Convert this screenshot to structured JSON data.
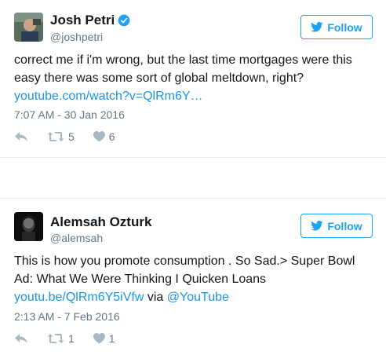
{
  "colors": {
    "accent": "#1da1f2",
    "link": "#1b95e0",
    "muted": "#657786",
    "icon": "#aab8c2",
    "text": "#14171a"
  },
  "tweets": [
    {
      "author": {
        "name": "Josh Petri",
        "handle": "@joshpetri",
        "verified": true,
        "avatar_icon": "profile-photo"
      },
      "follow_label": "Follow",
      "text": "correct me if i'm wrong, but the last time mortgages were this easy there was some sort of global meltdown, right?",
      "link_text": "youtube.com/watch?v=QlRm6Y…",
      "timestamp": "7:07 AM - 30 Jan 2016",
      "reply_icon": "reply-icon",
      "retweets": "5",
      "likes": "6"
    },
    {
      "author": {
        "name": "Alemsah Ozturk",
        "handle": "@alemsah",
        "verified": false,
        "avatar_icon": "profile-photo"
      },
      "follow_label": "Follow",
      "text": "This is how you promote consumption . So Sad.> Super Bowl Ad: What We Were Thinking I Quicken Loans",
      "link_text": "youtu.be/QlRm6Y5iVfw",
      "via_text": "via",
      "mention_text": "@YouTube",
      "timestamp": "2:13 AM - 7 Feb 2016",
      "reply_icon": "reply-icon",
      "retweets": "1",
      "likes": "1"
    }
  ]
}
